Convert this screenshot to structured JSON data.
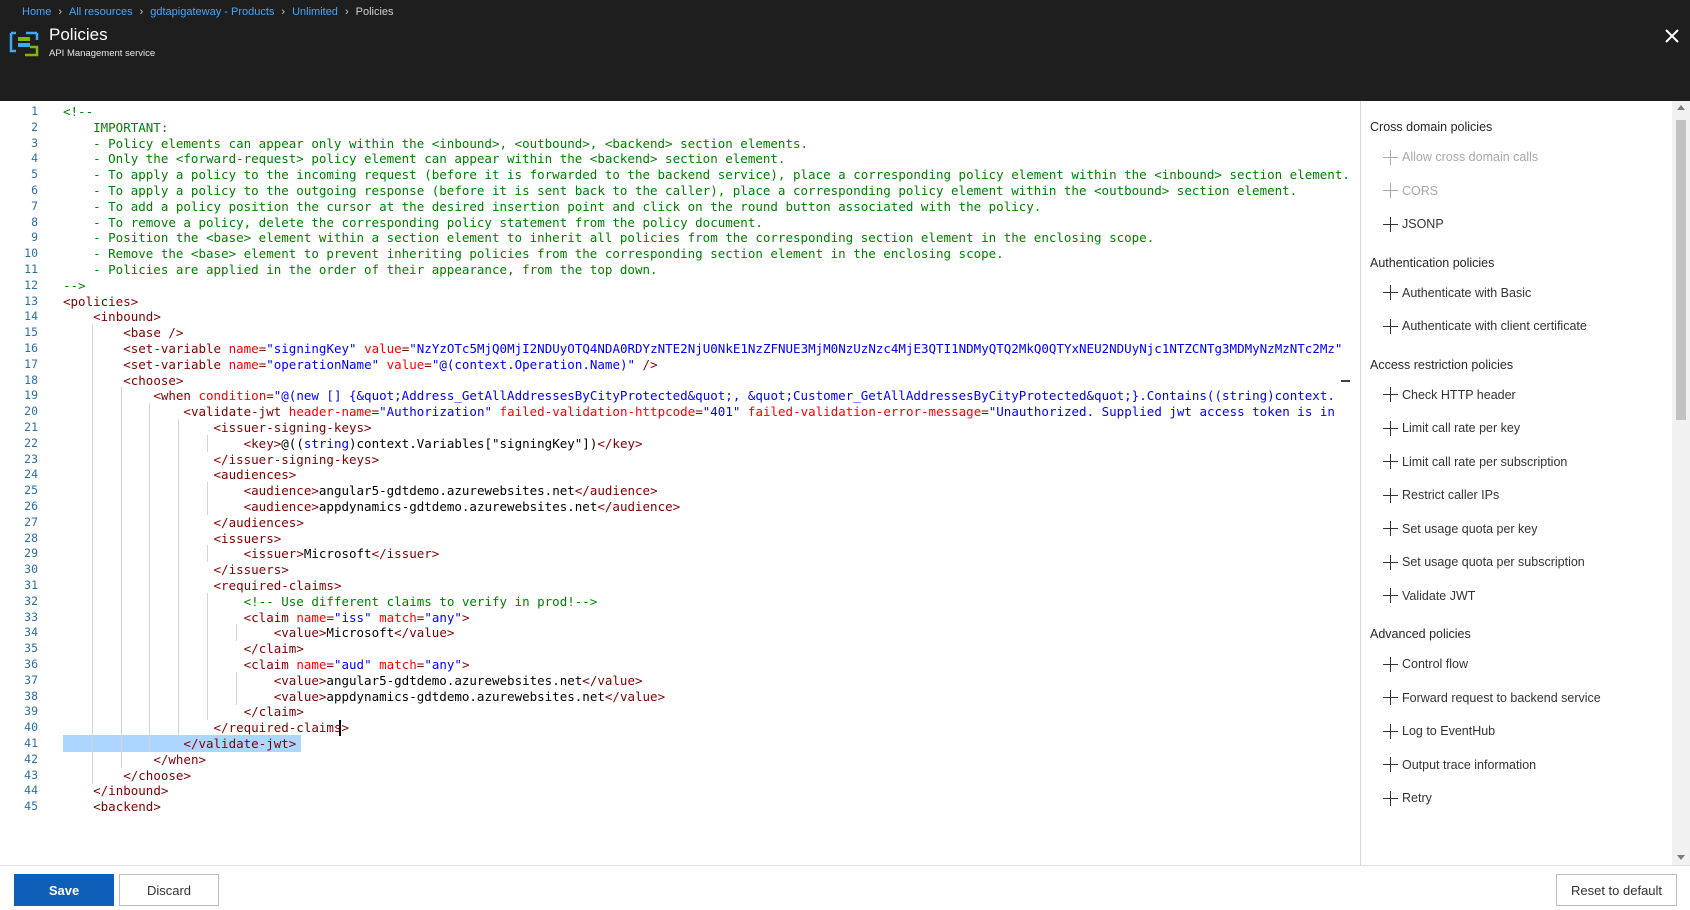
{
  "breadcrumb": {
    "items": [
      "Home",
      "All resources",
      "gdtapigateway - Products",
      "Unlimited"
    ],
    "current": "Policies"
  },
  "header": {
    "title": "Policies",
    "subtitle": "API Management service",
    "logo_icon": "api-management-icon",
    "close_icon": "close-icon"
  },
  "editor": {
    "language": "xml",
    "selected_line": 41,
    "cursor_line": 40,
    "lines": [
      [
        [
          "c",
          "<!--"
        ]
      ],
      [
        [
          "c",
          "    IMPORTANT:"
        ]
      ],
      [
        [
          "c",
          "    - Policy elements can appear only within the <inbound>, <outbound>, <backend> section elements."
        ]
      ],
      [
        [
          "c",
          "    - Only the <forward-request> policy element can appear within the <backend> section element."
        ]
      ],
      [
        [
          "c",
          "    - To apply a policy to the incoming request (before it is forwarded to the backend service), place a corresponding policy element within the <inbound> section element."
        ]
      ],
      [
        [
          "c",
          "    - To apply a policy to the outgoing response (before it is sent back to the caller), place a corresponding policy element within the <outbound> section element."
        ]
      ],
      [
        [
          "c",
          "    - To add a policy position the cursor at the desired insertion point and click on the round button associated with the policy."
        ]
      ],
      [
        [
          "c",
          "    - To remove a policy, delete the corresponding policy statement from the policy document."
        ]
      ],
      [
        [
          "c",
          "    - Position the <base> element within a section element to inherit all policies from the corresponding section element in the enclosing scope."
        ]
      ],
      [
        [
          "c",
          "    - Remove the <base> element to prevent inheriting policies from the corresponding section element in the enclosing scope."
        ]
      ],
      [
        [
          "c",
          "    - Policies are applied in the order of their appearance, from the top down."
        ]
      ],
      [
        [
          "c",
          "-->"
        ]
      ],
      [
        [
          "g",
          "<"
        ],
        [
          "t",
          "policies"
        ],
        [
          "g",
          ">"
        ]
      ],
      [
        [
          "x",
          "    "
        ],
        [
          "g",
          "<"
        ],
        [
          "t",
          "inbound"
        ],
        [
          "g",
          ">"
        ]
      ],
      [
        [
          "x",
          "        "
        ],
        [
          "g",
          "<"
        ],
        [
          "t",
          "base"
        ],
        [
          "g",
          " />"
        ]
      ],
      [
        [
          "x",
          "        "
        ],
        [
          "g",
          "<"
        ],
        [
          "t",
          "set-variable"
        ],
        [
          "x",
          " "
        ],
        [
          "a",
          "name"
        ],
        [
          "g",
          "="
        ],
        [
          "s",
          "\"signingKey\""
        ],
        [
          "x",
          " "
        ],
        [
          "a",
          "value"
        ],
        [
          "g",
          "="
        ],
        [
          "s",
          "\"NzYzOTc5MjQ0MjI2NDUyOTQ4NDA0RDYzNTE2NjU0NkE1NzZFNUE3MjM0NzUzNzc4MjE3QTI1NDMyQTQ2MkQ0QTYxNEU2NDUyNjc1NTZCNTg3MDMyNzMzNTc2Mz\""
        ]
      ],
      [
        [
          "x",
          "        "
        ],
        [
          "g",
          "<"
        ],
        [
          "t",
          "set-variable"
        ],
        [
          "x",
          " "
        ],
        [
          "a",
          "name"
        ],
        [
          "g",
          "="
        ],
        [
          "s",
          "\"operationName\""
        ],
        [
          "x",
          " "
        ],
        [
          "a",
          "value"
        ],
        [
          "g",
          "="
        ],
        [
          "s",
          "\"@(context.Operation.Name)\""
        ],
        [
          "g",
          " />"
        ]
      ],
      [
        [
          "x",
          "        "
        ],
        [
          "g",
          "<"
        ],
        [
          "t",
          "choose"
        ],
        [
          "g",
          ">"
        ]
      ],
      [
        [
          "x",
          "            "
        ],
        [
          "g",
          "<"
        ],
        [
          "t",
          "when"
        ],
        [
          "x",
          " "
        ],
        [
          "a",
          "condition"
        ],
        [
          "g",
          "="
        ],
        [
          "s",
          "\"@(new [] {&quot;Address_GetAllAddressesByCityProtected&quot;, &quot;Customer_GetAllAddressesByCityProtected&quot;}.Contains((string)context."
        ]
      ],
      [
        [
          "x",
          "                "
        ],
        [
          "g",
          "<"
        ],
        [
          "t",
          "validate-jwt"
        ],
        [
          "x",
          " "
        ],
        [
          "a",
          "header-name"
        ],
        [
          "g",
          "="
        ],
        [
          "s",
          "\"Authorization\""
        ],
        [
          "x",
          " "
        ],
        [
          "a",
          "failed-validation-httpcode"
        ],
        [
          "g",
          "="
        ],
        [
          "s",
          "\"401\""
        ],
        [
          "x",
          " "
        ],
        [
          "a",
          "failed-validation-error-message"
        ],
        [
          "g",
          "="
        ],
        [
          "s",
          "\"Unauthorized. Supplied jwt access token is in"
        ]
      ],
      [
        [
          "x",
          "                    "
        ],
        [
          "g",
          "<"
        ],
        [
          "t",
          "issuer-signing-keys"
        ],
        [
          "g",
          ">"
        ]
      ],
      [
        [
          "x",
          "                        "
        ],
        [
          "g",
          "<"
        ],
        [
          "t",
          "key"
        ],
        [
          "g",
          ">"
        ],
        [
          "x",
          "@(("
        ],
        [
          "k",
          "string"
        ],
        [
          "x",
          ")context.Variables[\"signingKey\"])"
        ],
        [
          "g",
          "</"
        ],
        [
          "t",
          "key"
        ],
        [
          "g",
          ">"
        ]
      ],
      [
        [
          "x",
          "                    "
        ],
        [
          "g",
          "</"
        ],
        [
          "t",
          "issuer-signing-keys"
        ],
        [
          "g",
          ">"
        ]
      ],
      [
        [
          "x",
          "                    "
        ],
        [
          "g",
          "<"
        ],
        [
          "t",
          "audiences"
        ],
        [
          "g",
          ">"
        ]
      ],
      [
        [
          "x",
          "                        "
        ],
        [
          "g",
          "<"
        ],
        [
          "t",
          "audience"
        ],
        [
          "g",
          ">"
        ],
        [
          "x",
          "angular5-gdtdemo.azurewebsites.net"
        ],
        [
          "g",
          "</"
        ],
        [
          "t",
          "audience"
        ],
        [
          "g",
          ">"
        ]
      ],
      [
        [
          "x",
          "                        "
        ],
        [
          "g",
          "<"
        ],
        [
          "t",
          "audience"
        ],
        [
          "g",
          ">"
        ],
        [
          "x",
          "appdynamics-gdtdemo.azurewebsites.net"
        ],
        [
          "g",
          "</"
        ],
        [
          "t",
          "audience"
        ],
        [
          "g",
          ">"
        ]
      ],
      [
        [
          "x",
          "                    "
        ],
        [
          "g",
          "</"
        ],
        [
          "t",
          "audiences"
        ],
        [
          "g",
          ">"
        ]
      ],
      [
        [
          "x",
          "                    "
        ],
        [
          "g",
          "<"
        ],
        [
          "t",
          "issuers"
        ],
        [
          "g",
          ">"
        ]
      ],
      [
        [
          "x",
          "                        "
        ],
        [
          "g",
          "<"
        ],
        [
          "t",
          "issuer"
        ],
        [
          "g",
          ">"
        ],
        [
          "x",
          "Microsoft"
        ],
        [
          "g",
          "</"
        ],
        [
          "t",
          "issuer"
        ],
        [
          "g",
          ">"
        ]
      ],
      [
        [
          "x",
          "                    "
        ],
        [
          "g",
          "</"
        ],
        [
          "t",
          "issuers"
        ],
        [
          "g",
          ">"
        ]
      ],
      [
        [
          "x",
          "                    "
        ],
        [
          "g",
          "<"
        ],
        [
          "t",
          "required-claims"
        ],
        [
          "g",
          ">"
        ]
      ],
      [
        [
          "x",
          "                        "
        ],
        [
          "c",
          "<!-- Use different claims to verify in prod!-->"
        ]
      ],
      [
        [
          "x",
          "                        "
        ],
        [
          "g",
          "<"
        ],
        [
          "t",
          "claim"
        ],
        [
          "x",
          " "
        ],
        [
          "a",
          "name"
        ],
        [
          "g",
          "="
        ],
        [
          "s",
          "\"iss\""
        ],
        [
          "x",
          " "
        ],
        [
          "a",
          "match"
        ],
        [
          "g",
          "="
        ],
        [
          "s",
          "\"any\""
        ],
        [
          "g",
          ">"
        ]
      ],
      [
        [
          "x",
          "                            "
        ],
        [
          "g",
          "<"
        ],
        [
          "t",
          "value"
        ],
        [
          "g",
          ">"
        ],
        [
          "x",
          "Microsoft"
        ],
        [
          "g",
          "</"
        ],
        [
          "t",
          "value"
        ],
        [
          "g",
          ">"
        ]
      ],
      [
        [
          "x",
          "                        "
        ],
        [
          "g",
          "</"
        ],
        [
          "t",
          "claim"
        ],
        [
          "g",
          ">"
        ]
      ],
      [
        [
          "x",
          "                        "
        ],
        [
          "g",
          "<"
        ],
        [
          "t",
          "claim"
        ],
        [
          "x",
          " "
        ],
        [
          "a",
          "name"
        ],
        [
          "g",
          "="
        ],
        [
          "s",
          "\"aud\""
        ],
        [
          "x",
          " "
        ],
        [
          "a",
          "match"
        ],
        [
          "g",
          "="
        ],
        [
          "s",
          "\"any\""
        ],
        [
          "g",
          ">"
        ]
      ],
      [
        [
          "x",
          "                            "
        ],
        [
          "g",
          "<"
        ],
        [
          "t",
          "value"
        ],
        [
          "g",
          ">"
        ],
        [
          "x",
          "angular5-gdtdemo.azurewebsites.net"
        ],
        [
          "g",
          "</"
        ],
        [
          "t",
          "value"
        ],
        [
          "g",
          ">"
        ]
      ],
      [
        [
          "x",
          "                            "
        ],
        [
          "g",
          "<"
        ],
        [
          "t",
          "value"
        ],
        [
          "g",
          ">"
        ],
        [
          "x",
          "appdynamics-gdtdemo.azurewebsites.net"
        ],
        [
          "g",
          "</"
        ],
        [
          "t",
          "value"
        ],
        [
          "g",
          ">"
        ]
      ],
      [
        [
          "x",
          "                        "
        ],
        [
          "g",
          "</"
        ],
        [
          "t",
          "claim"
        ],
        [
          "g",
          ">"
        ]
      ],
      [
        [
          "x",
          "                    "
        ],
        [
          "g",
          "</"
        ],
        [
          "t",
          "required-claims"
        ],
        [
          "g",
          ">"
        ]
      ],
      [
        [
          "x",
          "                "
        ],
        [
          "g",
          "</"
        ],
        [
          "t",
          "validate-jwt"
        ],
        [
          "g",
          ">"
        ]
      ],
      [
        [
          "x",
          "            "
        ],
        [
          "g",
          "</"
        ],
        [
          "t",
          "when"
        ],
        [
          "g",
          ">"
        ]
      ],
      [
        [
          "x",
          "        "
        ],
        [
          "g",
          "</"
        ],
        [
          "t",
          "choose"
        ],
        [
          "g",
          ">"
        ]
      ],
      [
        [
          "x",
          "    "
        ],
        [
          "g",
          "</"
        ],
        [
          "t",
          "inbound"
        ],
        [
          "g",
          ">"
        ]
      ],
      [
        [
          "x",
          "    "
        ],
        [
          "g",
          "<"
        ],
        [
          "t",
          "backend"
        ],
        [
          "g",
          ">"
        ]
      ]
    ]
  },
  "policy_panel": {
    "groups": [
      {
        "title": "Cross domain policies",
        "items": [
          {
            "label": "Allow cross domain calls",
            "enabled": false
          },
          {
            "label": "CORS",
            "enabled": false
          },
          {
            "label": "JSONP",
            "enabled": true
          }
        ]
      },
      {
        "title": "Authentication policies",
        "items": [
          {
            "label": "Authenticate with Basic",
            "enabled": true
          },
          {
            "label": "Authenticate with client certificate",
            "enabled": true
          }
        ]
      },
      {
        "title": "Access restriction policies",
        "items": [
          {
            "label": "Check HTTP header",
            "enabled": true
          },
          {
            "label": "Limit call rate per key",
            "enabled": true
          },
          {
            "label": "Limit call rate per subscription",
            "enabled": true
          },
          {
            "label": "Restrict caller IPs",
            "enabled": true
          },
          {
            "label": "Set usage quota per key",
            "enabled": true
          },
          {
            "label": "Set usage quota per subscription",
            "enabled": true
          },
          {
            "label": "Validate JWT",
            "enabled": true
          }
        ]
      },
      {
        "title": "Advanced policies",
        "items": [
          {
            "label": "Control flow",
            "enabled": true
          },
          {
            "label": "Forward request to backend service",
            "enabled": true
          },
          {
            "label": "Log to EventHub",
            "enabled": true
          },
          {
            "label": "Output trace information",
            "enabled": true
          },
          {
            "label": "Retry",
            "enabled": true
          }
        ]
      }
    ],
    "item_icon": "plus-icon"
  },
  "footer": {
    "save_label": "Save",
    "discard_label": "Discard",
    "reset_label": "Reset to default"
  },
  "colors": {
    "header_bg": "#1e1e1e",
    "breadcrumb_link": "#4aa5f5",
    "primary_button": "#0e5fb8",
    "comment": "#008000",
    "tag": "#800000",
    "attribute": "#ff0000",
    "string": "#0000ff",
    "line_number": "#2b6ea8",
    "selection": "#add6ff"
  }
}
